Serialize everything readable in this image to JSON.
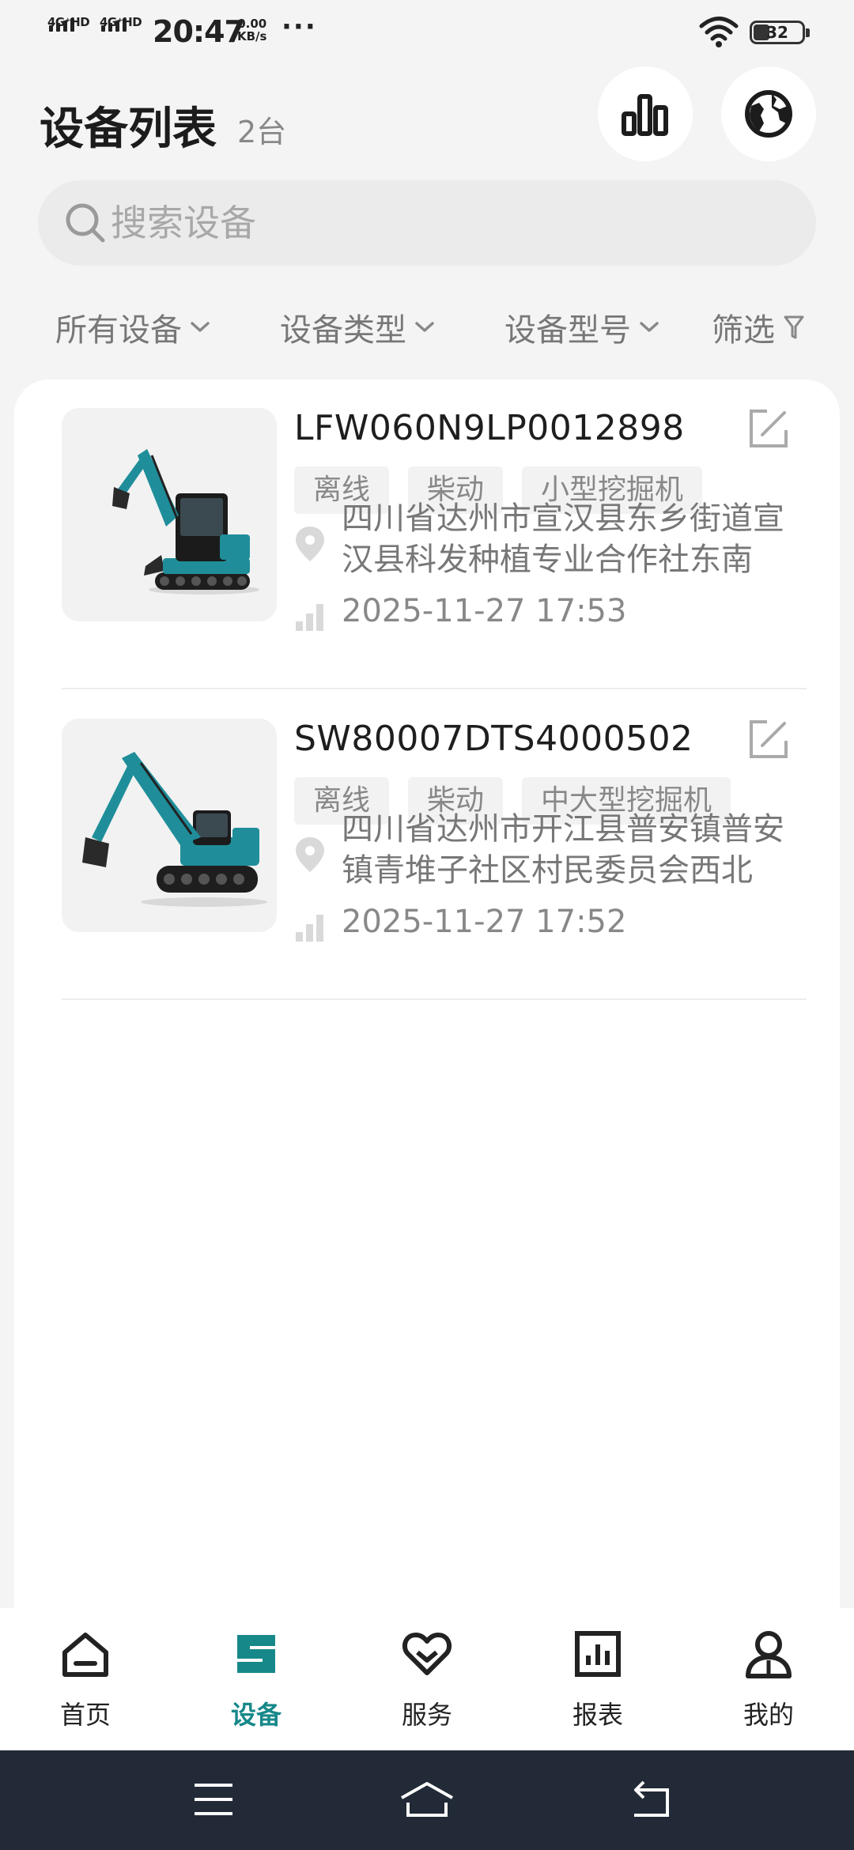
{
  "status_bar": {
    "signal1": "4G⁺HD",
    "signal2": "4G⁺HD",
    "time": "20:47",
    "net_speed_value": "0.00",
    "net_speed_unit": "KB/s",
    "more": "···",
    "battery": "32"
  },
  "header": {
    "title": "设备列表",
    "count": "2台",
    "stats_icon": "bar-chart-icon",
    "globe_icon": "globe-icon"
  },
  "search": {
    "placeholder": "搜索设备",
    "value": ""
  },
  "filters": [
    {
      "label": "所有设备",
      "icon": "chevron-down-icon"
    },
    {
      "label": "设备类型",
      "icon": "chevron-down-icon"
    },
    {
      "label": "设备型号",
      "icon": "chevron-down-icon"
    },
    {
      "label": "筛选",
      "icon": "filter-funnel-icon"
    }
  ],
  "devices": [
    {
      "serial": "LFW060N9LP0012898",
      "tags": [
        "离线",
        "柴动",
        "小型挖掘机"
      ],
      "address": "四川省达州市宣汉县东乡街道宣汉县科发种植专业合作社东南2...",
      "time": "2025-11-27 17:53"
    },
    {
      "serial": "SW80007DTS4000502",
      "tags": [
        "离线",
        "柴动",
        "中大型挖掘机"
      ],
      "address": "四川省达州市开江县普安镇普安镇青堆子社区村民委员会西北2...",
      "time": "2025-11-27 17:52"
    }
  ],
  "tab_bar": [
    {
      "label": "首页",
      "icon": "home-icon"
    },
    {
      "label": "设备",
      "icon": "device-s-logo-icon",
      "active": true
    },
    {
      "label": "服务",
      "icon": "service-heart-icon"
    },
    {
      "label": "报表",
      "icon": "report-chart-icon"
    },
    {
      "label": "我的",
      "icon": "user-icon"
    }
  ],
  "colors": {
    "accent": "#17888a",
    "background": "#f4f4f4",
    "nav_bar": "#212a36",
    "excavator_teal": "#1f8e9a"
  }
}
